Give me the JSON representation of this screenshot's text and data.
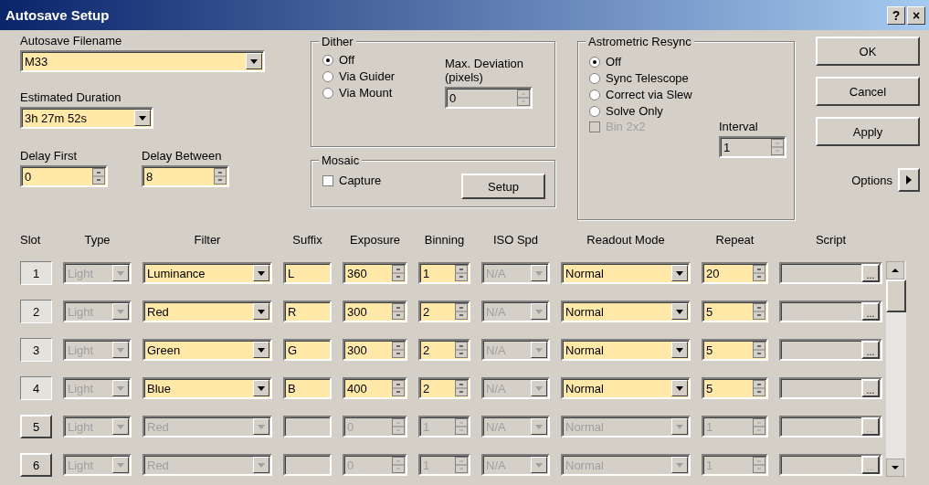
{
  "window": {
    "title": "Autosave Setup",
    "help": "?",
    "close": "×"
  },
  "autosave_filename": {
    "label": "Autosave Filename",
    "value": "M33"
  },
  "estimated_duration": {
    "label": "Estimated Duration",
    "value": "3h 27m 52s"
  },
  "delay_first": {
    "label": "Delay First",
    "value": "0"
  },
  "delay_between": {
    "label": "Delay Between",
    "value": "8"
  },
  "dither": {
    "title": "Dither",
    "options": [
      {
        "label": "Off",
        "selected": true
      },
      {
        "label": "Via Guider",
        "selected": false
      },
      {
        "label": "Via Mount",
        "selected": false
      }
    ],
    "max_deviation": {
      "label": "Max. Deviation (pixels)",
      "value": "0",
      "disabled": true
    }
  },
  "mosaic": {
    "title": "Mosaic",
    "capture": {
      "label": "Capture",
      "checked": false
    },
    "setup_button": "Setup"
  },
  "astrometric_resync": {
    "title": "Astrometric Resync",
    "options": [
      {
        "label": "Off",
        "selected": true
      },
      {
        "label": "Sync Telescope",
        "selected": false
      },
      {
        "label": "Correct via Slew",
        "selected": false
      },
      {
        "label": "Solve Only",
        "selected": false
      }
    ],
    "bin2x2": {
      "label": "Bin 2x2",
      "checked": false,
      "disabled": true
    },
    "interval": {
      "label": "Interval",
      "value": "1",
      "disabled": true
    }
  },
  "buttons": [
    "OK",
    "Cancel",
    "Apply"
  ],
  "options_label": "Options",
  "table": {
    "columns": [
      "Slot",
      "Type",
      "Filter",
      "Suffix",
      "Exposure",
      "Binning",
      "ISO Spd",
      "Readout Mode",
      "Repeat",
      "Script"
    ],
    "rows": [
      {
        "slot": "1",
        "type": "Light",
        "filter": "Luminance",
        "suffix": "L",
        "exposure": "360",
        "binning": "1",
        "iso": "N/A",
        "readout": "Normal",
        "repeat": "20",
        "script_button": "...",
        "enabled": true
      },
      {
        "slot": "2",
        "type": "Light",
        "filter": "Red",
        "suffix": "R",
        "exposure": "300",
        "binning": "2",
        "iso": "N/A",
        "readout": "Normal",
        "repeat": "5",
        "script_button": "...",
        "enabled": true
      },
      {
        "slot": "3",
        "type": "Light",
        "filter": "Green",
        "suffix": "G",
        "exposure": "300",
        "binning": "2",
        "iso": "N/A",
        "readout": "Normal",
        "repeat": "5",
        "script_button": "...",
        "enabled": true
      },
      {
        "slot": "4",
        "type": "Light",
        "filter": "Blue",
        "suffix": "B",
        "exposure": "400",
        "binning": "2",
        "iso": "N/A",
        "readout": "Normal",
        "repeat": "5",
        "script_button": "...",
        "enabled": true
      },
      {
        "slot": "5",
        "type": "Light",
        "filter": "Red",
        "suffix": "",
        "exposure": "0",
        "binning": "1",
        "iso": "N/A",
        "readout": "Normal",
        "repeat": "1",
        "script_button": "...",
        "enabled": false
      },
      {
        "slot": "6",
        "type": "Light",
        "filter": "Red",
        "suffix": "",
        "exposure": "0",
        "binning": "1",
        "iso": "N/A",
        "readout": "Normal",
        "repeat": "1",
        "script_button": "...",
        "enabled": false
      }
    ]
  }
}
